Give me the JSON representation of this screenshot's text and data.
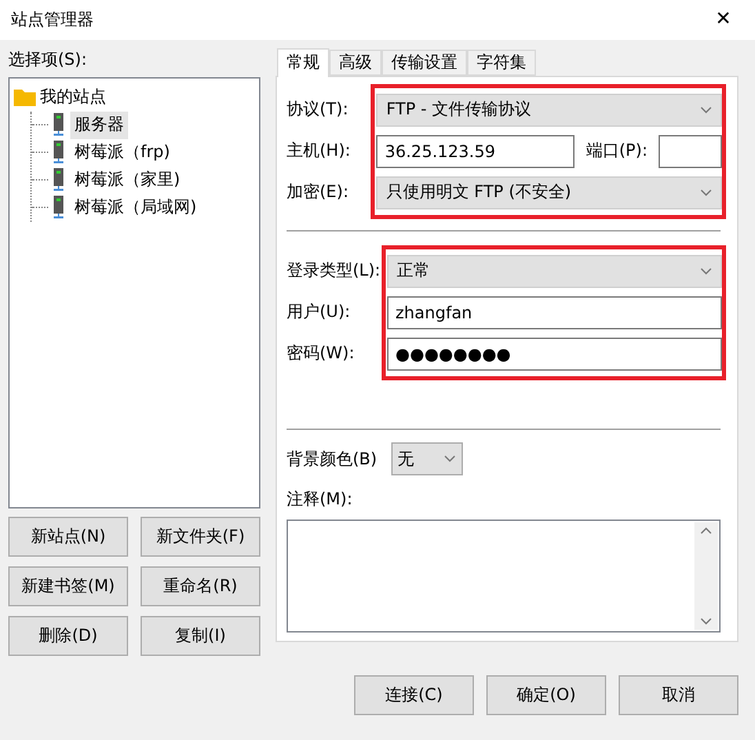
{
  "window": {
    "title": "站点管理器",
    "close": "✕"
  },
  "sidebar": {
    "label": "选择项(S):",
    "tree": [
      {
        "label": "我的站点",
        "kind": "folder",
        "selected": false,
        "expanded": true,
        "children": [
          {
            "label": "服务器",
            "kind": "server",
            "selected": true
          },
          {
            "label": "树莓派（frp)",
            "kind": "server",
            "selected": false
          },
          {
            "label": "树莓派（家里)",
            "kind": "server",
            "selected": false
          },
          {
            "label": "树莓派（局域网)",
            "kind": "server",
            "selected": false
          }
        ]
      }
    ],
    "buttons": [
      "新站点(N)",
      "新文件夹(F)",
      "新建书签(M)",
      "重命名(R)",
      "删除(D)",
      "复制(I)"
    ]
  },
  "tabs": [
    {
      "label": "常规",
      "selected": true
    },
    {
      "label": "高级",
      "selected": false
    },
    {
      "label": "传输设置",
      "selected": false
    },
    {
      "label": "字符集",
      "selected": false
    }
  ],
  "groups": [
    {
      "highlighted": true,
      "rows": [
        {
          "kind": "select",
          "label": "协议(T):",
          "value": "FTP - 文件传输协议"
        },
        {
          "kind": "host",
          "label": "主机(H):",
          "value": "36.25.123.59",
          "port_label": "端口(P):",
          "port_value": ""
        },
        {
          "kind": "select",
          "label": "加密(E):",
          "value": "只使用明文 FTP (不安全)"
        }
      ]
    },
    {
      "highlighted": true,
      "rows": [
        {
          "kind": "select",
          "label": "登录类型(L):",
          "value": "正常"
        },
        {
          "kind": "text",
          "label": "用户(U):",
          "value": "zhangfan"
        },
        {
          "kind": "text",
          "label": "密码(W):",
          "value": "●●●●●●●●"
        }
      ]
    }
  ],
  "background_color": {
    "label": "背景颜色(B)",
    "value": "无"
  },
  "notes": {
    "label": "注释(M):"
  },
  "footer_buttons": [
    "连接(C)",
    "确定(O)",
    "取消"
  ]
}
